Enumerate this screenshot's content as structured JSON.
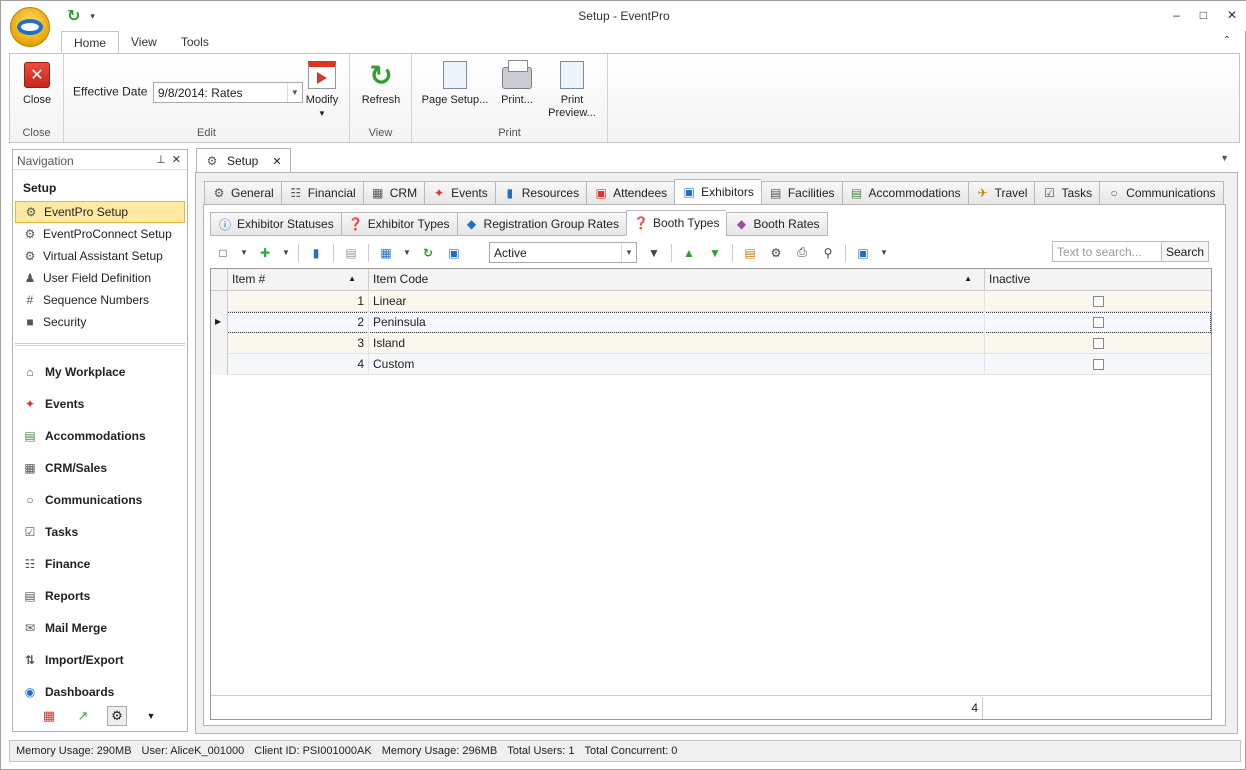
{
  "window": {
    "title": "Setup - EventPro"
  },
  "ribbon_tabs": [
    "Home",
    "View",
    "Tools"
  ],
  "ribbon": {
    "close_label": "Close",
    "close_group": "Close",
    "effective_date_label": "Effective Date",
    "effective_date_value": "9/8/2014: Rates",
    "modify_label": "Modify",
    "edit_group": "Edit",
    "refresh_label": "Refresh",
    "view_group": "View",
    "page_setup_label": "Page Setup...",
    "print_label": "Print...",
    "print_preview_label": "Print Preview...",
    "print_group": "Print"
  },
  "nav": {
    "header": "Navigation",
    "section": "Setup",
    "items": [
      "EventPro Setup",
      "EventProConnect Setup",
      "Virtual Assistant Setup",
      "User Field Definition",
      "Sequence Numbers",
      "Security"
    ],
    "modules": [
      "My Workplace",
      "Events",
      "Accommodations",
      "CRM/Sales",
      "Communications",
      "Tasks",
      "Finance",
      "Reports",
      "Mail Merge",
      "Import/Export",
      "Dashboards"
    ]
  },
  "doc_tab": "Setup",
  "main_tabs": [
    "General",
    "Financial",
    "CRM",
    "Events",
    "Resources",
    "Attendees",
    "Exhibitors",
    "Facilities",
    "Accommodations",
    "Travel",
    "Tasks",
    "Communications"
  ],
  "sub_tabs": [
    "Exhibitor Statuses",
    "Exhibitor Types",
    "Registration Group Rates",
    "Booth Types",
    "Booth Rates"
  ],
  "toolbar": {
    "filter_value": "Active",
    "search_placeholder": "Text to search...",
    "search_button": "Search"
  },
  "grid": {
    "columns": [
      "Item #",
      "Item Code",
      "Inactive"
    ],
    "rows": [
      {
        "num": "1",
        "code": "Linear",
        "inactive": false
      },
      {
        "num": "2",
        "code": "Peninsula",
        "inactive": false
      },
      {
        "num": "3",
        "code": "Island",
        "inactive": false
      },
      {
        "num": "4",
        "code": "Custom",
        "inactive": false
      }
    ],
    "footer_count": "4"
  },
  "status": [
    "Memory Usage: 290MB",
    "User: AliceK_001000",
    "Client ID: PSI001000AK",
    "Memory Usage: 296MB",
    "Total Users: 1",
    "Total Concurrent: 0"
  ],
  "colors": {
    "nav_selected": "#fde9a2",
    "accent": "#1d6fc9"
  }
}
